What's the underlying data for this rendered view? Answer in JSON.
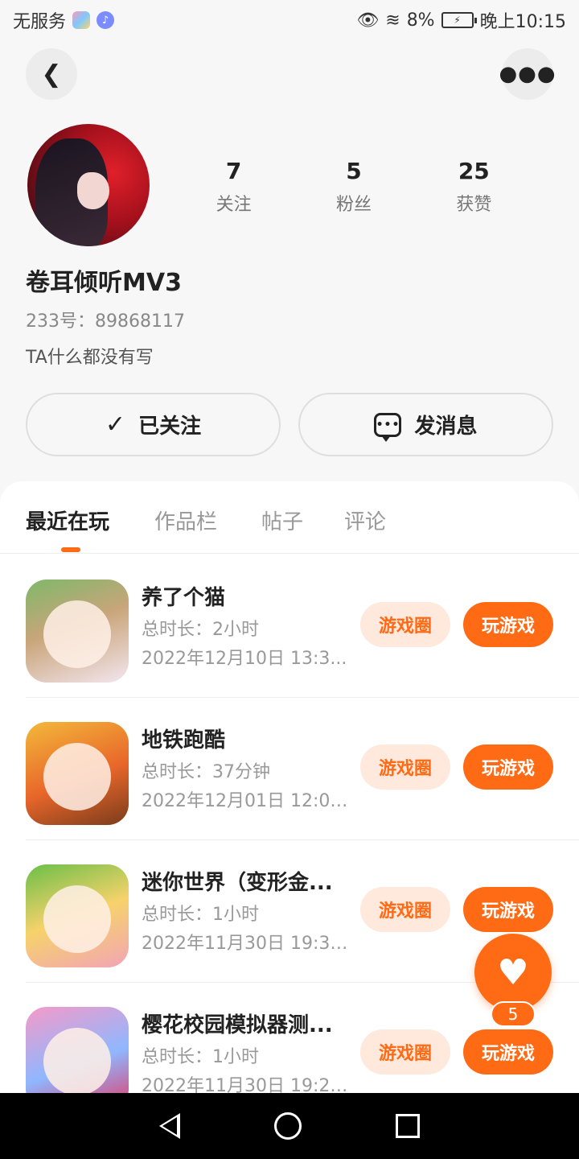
{
  "status_bar": {
    "carrier": "无服务",
    "battery": "8%",
    "time": "晚上10:15"
  },
  "profile": {
    "username": "卷耳倾听MV3",
    "id_text": "233号：89868117",
    "bio": "TA什么都没有写",
    "stats": [
      {
        "value": "7",
        "label": "关注"
      },
      {
        "value": "5",
        "label": "粉丝"
      },
      {
        "value": "25",
        "label": "获赞"
      }
    ]
  },
  "actions": {
    "follow_label": "已关注",
    "message_label": "发消息"
  },
  "tabs": [
    "最近在玩",
    "作品栏",
    "帖子",
    "评论"
  ],
  "games": [
    {
      "name": "养了个猫",
      "duration": "总时长：2小时",
      "date": "2022年12月10日 13:3...",
      "circle_label": "游戏圈",
      "play_label": "玩游戏"
    },
    {
      "name": "地铁跑酷",
      "duration": "总时长：37分钟",
      "date": "2022年12月01日 12:00...",
      "circle_label": "游戏圈",
      "play_label": "玩游戏"
    },
    {
      "name": "迷你世界（变形金...",
      "duration": "总时长：1小时",
      "date": "2022年11月30日 19:30...",
      "circle_label": "游戏圈",
      "play_label": "玩游戏"
    },
    {
      "name": "樱花校园模拟器测...",
      "duration": "总时长：1小时",
      "date": "2022年11月30日 19:27...",
      "circle_label": "游戏圈",
      "play_label": "玩游戏"
    }
  ],
  "floating_like": {
    "count": "5"
  },
  "colors": {
    "accent": "#ff6a14",
    "accent_light": "#ffe8dc"
  }
}
